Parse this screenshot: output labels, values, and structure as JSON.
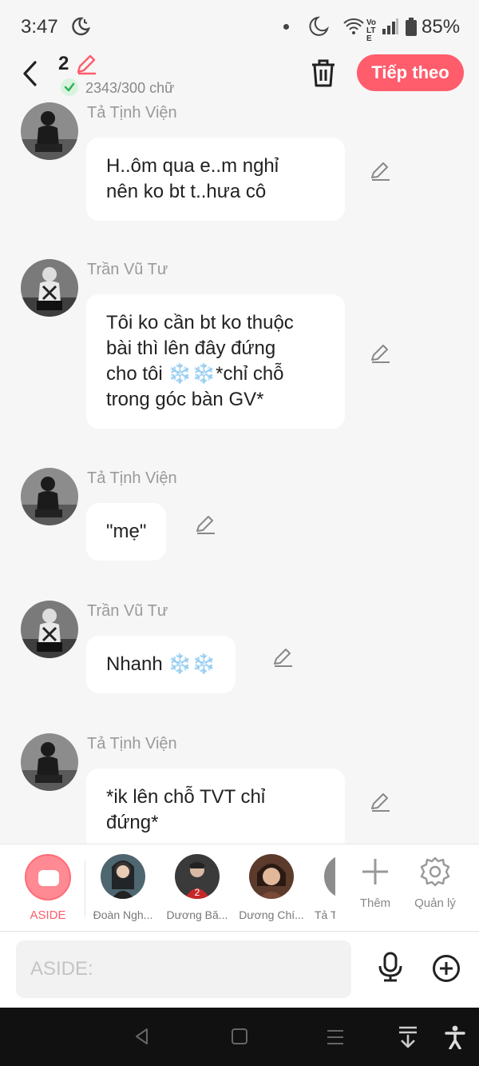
{
  "status_bar": {
    "time": "3:47",
    "battery": "85%",
    "network": "Vo LTE"
  },
  "header": {
    "chapter_number": "2",
    "word_count": "2343/300 chữ",
    "next_label": "Tiếp theo"
  },
  "messages": [
    {
      "sender": "Tả Tịnh Viện",
      "lines": [
        "H..ôm qua e..m nghỉ",
        "nên ko bt t..hưa cô"
      ]
    },
    {
      "sender": "Trần Vũ Tư",
      "lines": [
        "Tôi ko cần bt ko thuộc",
        "bài thì lên đây đứng",
        "cho tôi ❄️❄️*chỉ chỗ",
        "trong góc bàn GV*"
      ]
    },
    {
      "sender": "Tả Tịnh Viện",
      "lines": [
        "\"mẹ\""
      ]
    },
    {
      "sender": "Trần Vũ Tư",
      "lines": [
        "Nhanh ❄️❄️"
      ]
    },
    {
      "sender": "Tả Tịnh Viện",
      "lines": [
        "*ik lên chỗ TVT chỉ",
        "đứng*"
      ]
    }
  ],
  "characters": {
    "aside_label": "ASIDE",
    "list": [
      "Đoàn Ngh...",
      "Dương Bă...",
      "Dương Chí...",
      "Tả T"
    ],
    "add_label": "Thêm",
    "manage_label": "Quản lý"
  },
  "input": {
    "placeholder": "ASIDE:"
  },
  "colors": {
    "accent": "#ff5c6c",
    "check": "#2fb45a",
    "bubble": "#ffffff",
    "background": "#f6f6f6"
  },
  "icons": [
    "back-arrow",
    "pencil",
    "check",
    "trash",
    "edit",
    "plus",
    "gear",
    "microphone",
    "plus-circle"
  ]
}
